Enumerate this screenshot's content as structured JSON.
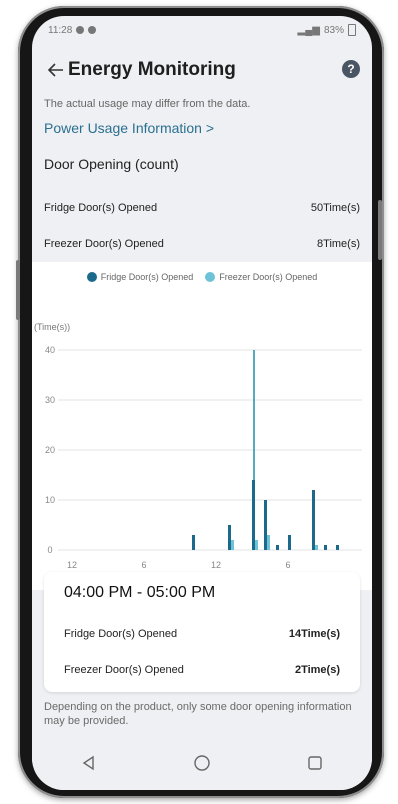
{
  "status": {
    "time": "11:28",
    "battery": "83%"
  },
  "header": {
    "title": "Energy Monitoring"
  },
  "note": "The actual usage may differ from the data.",
  "power_link": "Power Usage Information >",
  "section_title": "Door Opening (count)",
  "rows": [
    {
      "label": "Fridge Door(s) Opened",
      "value": "50Time(s)"
    },
    {
      "label": "Freezer Door(s) Opened",
      "value": "8Time(s)"
    }
  ],
  "chart_data": {
    "type": "bar",
    "ylabel": "(Time(s))",
    "yticks": [
      0,
      10,
      20,
      30,
      40
    ],
    "ylim": [
      0,
      40
    ],
    "xticks": [
      "12",
      "6",
      "12",
      "6"
    ],
    "legend": [
      {
        "label": "Fridge Door(s) Opened",
        "color": "#1b6a8c"
      },
      {
        "label": "Freezer Door(s) Opened",
        "color": "#6ec3d6"
      }
    ],
    "series": [
      {
        "name": "Fridge Door(s) Opened",
        "values": [
          {
            "hour": 10,
            "value": 3
          },
          {
            "hour": 13,
            "value": 5
          },
          {
            "hour": 15,
            "value": 14
          },
          {
            "hour": 16,
            "value": 10
          },
          {
            "hour": 17,
            "value": 1
          },
          {
            "hour": 18,
            "value": 3
          },
          {
            "hour": 20,
            "value": 12
          },
          {
            "hour": 21,
            "value": 1
          },
          {
            "hour": 22,
            "value": 1
          }
        ]
      },
      {
        "name": "Freezer Door(s) Opened",
        "values": [
          {
            "hour": 13,
            "value": 2
          },
          {
            "hour": 15,
            "value": 2
          },
          {
            "hour": 16,
            "value": 3
          },
          {
            "hour": 20,
            "value": 1
          }
        ]
      }
    ],
    "selected_hour": 15,
    "selected_peak": 40
  },
  "summary": {
    "time_range": "04:00 PM - 05:00 PM",
    "rows": [
      {
        "label": "Fridge Door(s) Opened",
        "value": "14Time(s)"
      },
      {
        "label": "Freezer Door(s) Opened",
        "value": "2Time(s)"
      }
    ]
  },
  "disclaimer": "Depending on the product, only some door opening information may be provided."
}
